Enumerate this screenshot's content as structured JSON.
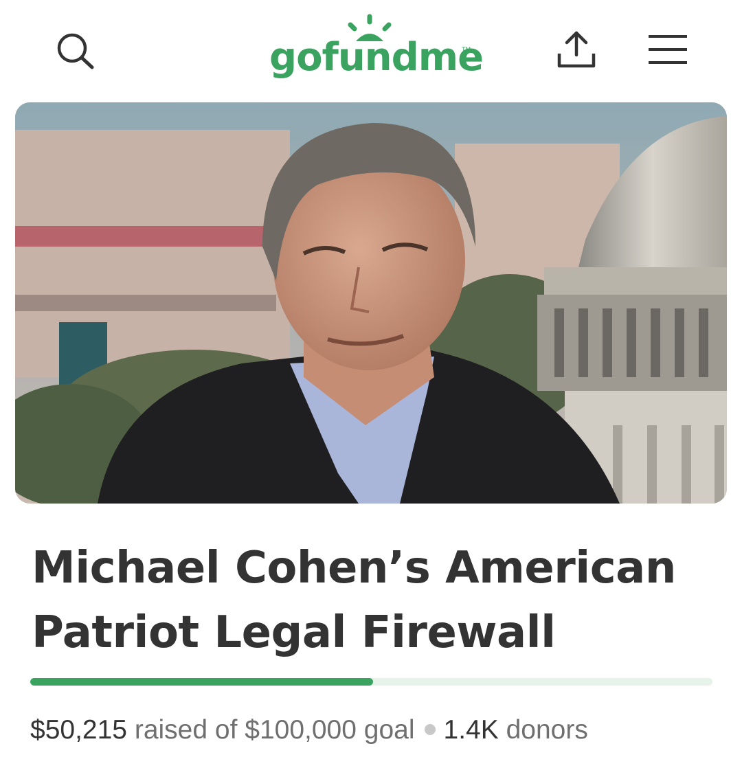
{
  "header": {
    "logo_text": "gofundme",
    "logo_tm": "TM",
    "icons": {
      "search": "search-icon",
      "share": "share-icon",
      "menu": "hamburger-menu-icon"
    }
  },
  "campaign": {
    "image": "campaign-photo",
    "title": "Michael Cohen’s American Patriot Legal Firewall",
    "progress_fraction": 0.50215,
    "raised_amount": "$50,215",
    "raised_label": "raised of",
    "goal_amount": "$100,000",
    "goal_label": "goal",
    "donor_count": "1.4K",
    "donor_label": "donors"
  },
  "colors": {
    "brand_green": "#3aa35f",
    "progress_track": "#e6f3ea",
    "text_dark": "#333333",
    "text_muted": "#6f6f6f"
  }
}
